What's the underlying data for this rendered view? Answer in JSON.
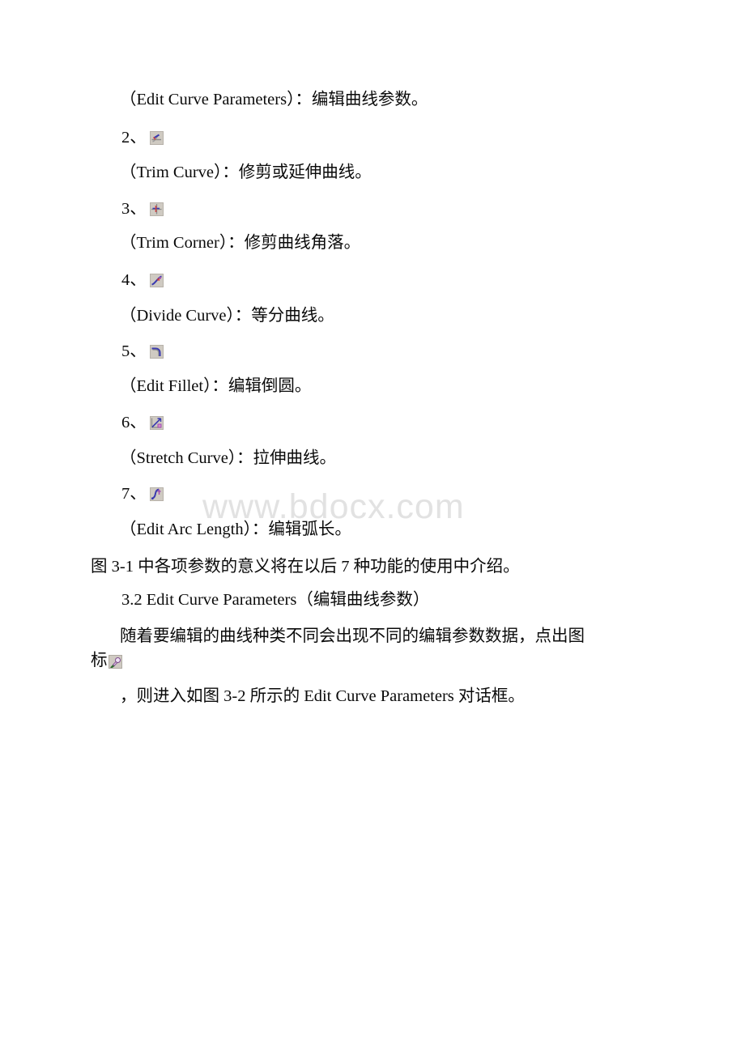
{
  "document": {
    "watermark": "www.bdocx.com",
    "entries": [
      {
        "number": "",
        "icon_name": "edit-curve-parameters-icon",
        "caption": "（Edit Curve Parameters）：编辑曲线参数。"
      },
      {
        "number": "2、",
        "icon_name": "trim-curve-icon",
        "caption": "（Trim Curve）：修剪或延伸曲线。"
      },
      {
        "number": "3、",
        "icon_name": "trim-corner-icon",
        "caption": "（Trim Corner）：修剪曲线角落。"
      },
      {
        "number": "4、",
        "icon_name": "divide-curve-icon",
        "caption": "（Divide Curve）：等分曲线。"
      },
      {
        "number": "5、",
        "icon_name": "edit-fillet-icon",
        "caption": "（Edit Fillet）：编辑倒圆。"
      },
      {
        "number": "6、",
        "icon_name": "stretch-curve-icon",
        "caption": "（Stretch Curve）：拉伸曲线。"
      },
      {
        "number": "7、",
        "icon_name": "edit-arc-length-icon",
        "caption": "（Edit Arc Length）：编辑弧长。"
      }
    ],
    "note_line": "图 3-1 中各项参数的意义将在以后 7 种功能的使用中介绍。",
    "section_heading": "3.2 Edit Curve Parameters（编辑曲线参数）",
    "body_paragraph_line1": "随着要编辑的曲线种类不同会出现不同的编辑参数数据，点出图",
    "body_paragraph_line2_prefix": "标",
    "body_paragraph_line3": "，则进入如图 3-2 所示的 Edit Curve Parameters 对话框。"
  },
  "colors": {
    "text": "#0a0a0a",
    "watermark": "#e2e2e2",
    "icon_background": "#cfcac2",
    "icon_blue": "#3a3ab0",
    "icon_red": "#d04040",
    "icon_purple": "#a050b0",
    "icon_gray": "#8a8a8a"
  }
}
